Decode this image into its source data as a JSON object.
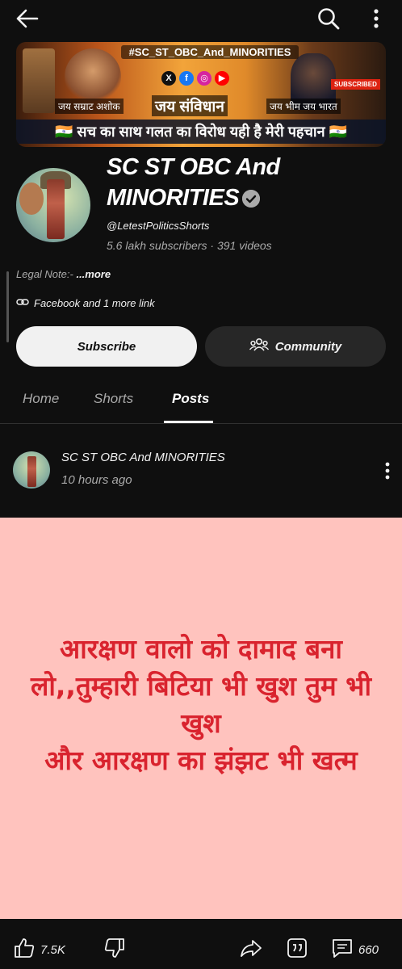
{
  "banner": {
    "hashtag": "#SC_ST_OBC_And_MINORITIES",
    "left_caption": "जय सम्राट अशोक",
    "center_caption": "जय संविधान",
    "right_caption": "जय भीम जय भारत",
    "slogan": "🇮🇳 सच का साथ गलत का विरोध यही है मेरी पहचान 🇮🇳",
    "subscribed_badge": "SUBSCRIBED"
  },
  "channel": {
    "name": "SC ST OBC And MINORITIES",
    "handle": "@LetestPoliticsShorts",
    "subscribers": "5.6 lakh subscribers",
    "separator": "·",
    "videos": "391 videos",
    "legal_label": "Legal Note:-",
    "more_label": "...more",
    "links_text": "Facebook and 1 more link"
  },
  "buttons": {
    "subscribe": "Subscribe",
    "community": "Community"
  },
  "tabs": [
    {
      "label": "Home"
    },
    {
      "label": "Shorts"
    },
    {
      "label": "Posts"
    }
  ],
  "active_tab": "Posts",
  "post": {
    "author": "SC ST OBC And MINORITIES",
    "time": "10 hours ago",
    "text": "आरक्षण वालो को दामाद बना लो,,तुम्हारी बिटिया भी खुश तुम भी खुश\n और आरक्षण का झंझट भी खत्म",
    "likes": "7.5K",
    "comments": "660"
  },
  "colors": {
    "background": "#0f0f0f",
    "post_bg": "#ffc3be",
    "post_text": "#d9232e"
  }
}
